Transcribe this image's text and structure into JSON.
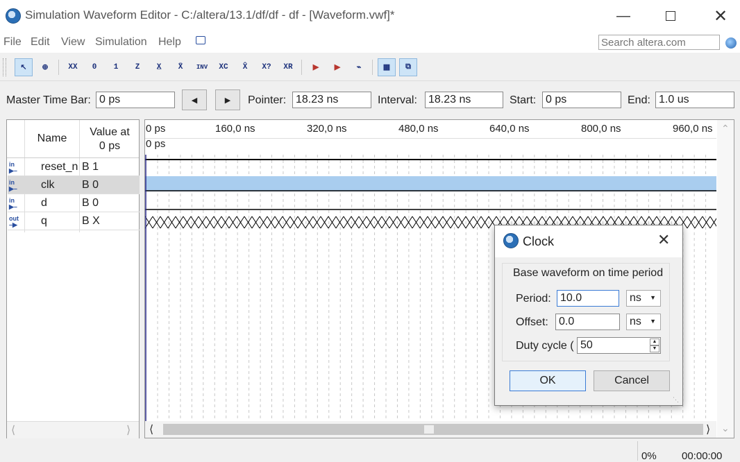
{
  "window": {
    "title": "Simulation Waveform Editor - C:/altera/13.1/df/df - df - [Waveform.vwf]*"
  },
  "menu": [
    "File",
    "Edit",
    "View",
    "Simulation",
    "Help"
  ],
  "search": {
    "placeholder": "Search altera.com"
  },
  "toolbar": {
    "icons": [
      "selection-tool-icon",
      "zoom-tool-icon",
      "forcing-unknown-icon",
      "forcing-low-icon",
      "forcing-high-icon",
      "high-impedance-icon",
      "weak-low-icon",
      "weak-high-icon",
      "invert-icon",
      "count-value-icon",
      "clock-icon",
      "arbitrary-value-icon",
      "random-value-icon",
      "snap-to-grid-icon",
      "run-functional-icon",
      "run-timing-icon",
      "generate-netlist-icon",
      "grid-toggle-icon",
      "fullscreen-icon"
    ],
    "glyphs": [
      "↖",
      "⊕",
      "XX",
      "0",
      "1",
      "Z",
      "X̲",
      "X̄",
      "INV",
      "XC",
      "X̂",
      "X?",
      "XR",
      "▶",
      "▶",
      "⌁",
      "▦",
      "⧉"
    ]
  },
  "timebar": {
    "master_label": "Master Time Bar:",
    "master_value": "0 ps",
    "pointer_label": "Pointer:",
    "pointer_value": "18.23 ns",
    "interval_label": "Interval:",
    "interval_value": "18.23 ns",
    "start_label": "Start:",
    "start_value": "0 ps",
    "end_label": "End:",
    "end_value": "1.0 us"
  },
  "signals_panel": {
    "name_header": "Name",
    "value_header_line1": "Value at",
    "value_header_line2": "0 ps",
    "rows": [
      {
        "dir": "in",
        "name": "reset_n",
        "value": "B 1"
      },
      {
        "dir": "in",
        "name": "clk",
        "value": "B 0"
      },
      {
        "dir": "in",
        "name": "d",
        "value": "B 0"
      },
      {
        "dir": "out",
        "name": "q",
        "value": "B X"
      }
    ]
  },
  "waveform": {
    "ticks": [
      "0 ps",
      "160,0 ns",
      "320,0 ns",
      "480,0 ns",
      "640,0 ns",
      "800,0 ns",
      "960,0 ns"
    ],
    "cursor_label": "0 ps"
  },
  "dialog": {
    "title": "Clock",
    "group_label": "Base waveform on time period",
    "period_label": "Period:",
    "period_value": "10.0",
    "period_unit": "ns",
    "offset_label": "Offset:",
    "offset_value": "0.0",
    "offset_unit": "ns",
    "duty_label": "Duty cycle (",
    "duty_value": "50",
    "ok_label": "OK",
    "cancel_label": "Cancel"
  },
  "status": {
    "progress": "0%",
    "elapsed": "00:00:00"
  }
}
